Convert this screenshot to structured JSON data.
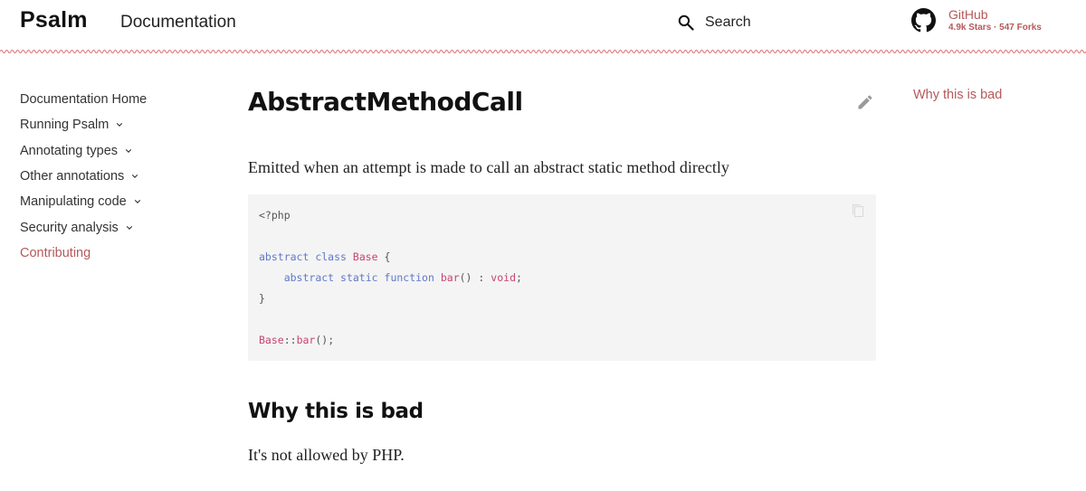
{
  "header": {
    "logo": "Psalm",
    "doc_link": "Documentation",
    "search_label": "Search",
    "github_title": "GitHub",
    "github_stats": "4.9k Stars · 547 Forks"
  },
  "sidebar": {
    "items": [
      {
        "label": "Documentation Home",
        "active": true,
        "chevron": false
      },
      {
        "label": "Running Psalm",
        "active": false,
        "chevron": true
      },
      {
        "label": "Annotating types",
        "active": false,
        "chevron": true
      },
      {
        "label": "Other annotations",
        "active": false,
        "chevron": true
      },
      {
        "label": "Manipulating code",
        "active": false,
        "chevron": true
      },
      {
        "label": "Security analysis",
        "active": false,
        "chevron": true
      },
      {
        "label": "Contributing",
        "active": true,
        "chevron": false
      }
    ]
  },
  "main": {
    "title": "AbstractMethodCall",
    "lead": "Emitted when an attempt is made to call an abstract static method directly",
    "code": {
      "line1": "<?php",
      "abstract": "abstract",
      "class_kw": "class",
      "class_name": "Base",
      "brace_open": "{",
      "static_kw": "static",
      "function_kw": "function",
      "method": "bar",
      "parens": "()",
      "colon": ":",
      "return_type": "void",
      "semicolon": ";",
      "brace_close": "}",
      "call_class": "Base",
      "call_sep": "::",
      "call_method": "bar",
      "call_end": "();"
    },
    "section_heading": "Why this is bad",
    "section_text": "It's not allowed by PHP."
  },
  "toc": {
    "items": [
      "Why this is bad"
    ]
  },
  "colors": {
    "accent": "#b5595a",
    "keyword": "#6078c8",
    "identifier": "#c6456f",
    "code_bg": "#f4f4f4"
  },
  "icons": [
    "search-icon",
    "github-icon",
    "chevron-down-icon",
    "pencil-edit-icon",
    "copy-icon"
  ]
}
